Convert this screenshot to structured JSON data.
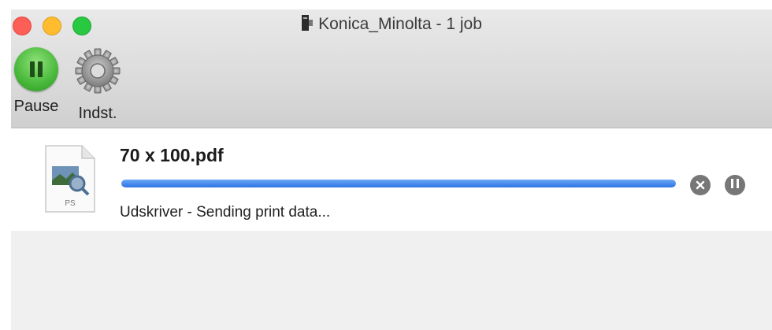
{
  "window": {
    "title": "Konica_Minolta - 1 job"
  },
  "toolbar": {
    "pause_label": "Pause",
    "settings_label": "Indst."
  },
  "job": {
    "name": "70 x 100.pdf",
    "file_type_badge": "PS",
    "status": "Udskriver - Sending print data...",
    "progress_fraction": 1.0
  },
  "icons": {
    "printer": "printer-icon",
    "pause": "pause-icon",
    "settings": "gear-icon",
    "cancel": "close-circle-icon",
    "job_pause": "pause-circle-icon",
    "document": "document-preview-icon"
  },
  "colors": {
    "progress": "#2f73e4",
    "pause_button": "#48b83a",
    "close_light": "#fd5f57",
    "minimize_light": "#febc2e",
    "zoom_light": "#28c840"
  }
}
